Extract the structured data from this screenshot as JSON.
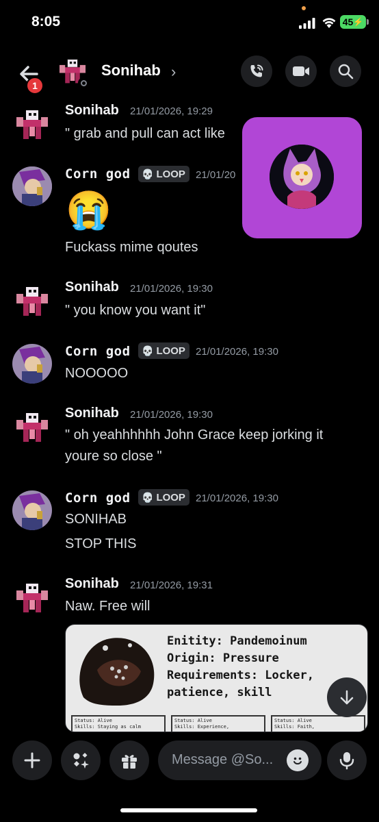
{
  "status_bar": {
    "time": "8:05",
    "battery": "45"
  },
  "header": {
    "name": "Sonihab",
    "chevron": "›",
    "unread_badge": "1",
    "buttons": [
      "back-arrow-icon",
      "phone-call-icon",
      "video-camera-icon",
      "search-icon"
    ]
  },
  "messages": [
    {
      "author": "Sonihab",
      "timestamp": "21/01/2026, 19:29",
      "lines": [
        "\" grab and pull can act like"
      ]
    },
    {
      "author": "Corn god",
      "tag": "LOOP",
      "timestamp": "21/01/20",
      "emoji": "😭",
      "lines": [
        "Fuckass mime qoutes"
      ]
    },
    {
      "author": "Sonihab",
      "timestamp": "21/01/2026, 19:30",
      "lines": [
        "\" you know you want it\""
      ]
    },
    {
      "author": "Corn god",
      "tag": "LOOP",
      "timestamp": "21/01/2026, 19:30",
      "lines": [
        "NOOOOO"
      ]
    },
    {
      "author": "Sonihab",
      "timestamp": "21/01/2026, 19:30",
      "lines": [
        "\" oh yeahhhhhh John Grace keep jorking it",
        "youre so close \""
      ]
    },
    {
      "author": "Corn god",
      "tag": "LOOP",
      "timestamp": "21/01/2026, 19:30",
      "lines": [
        "SONIHAB",
        "STOP THIS"
      ]
    },
    {
      "author": "Sonihab",
      "timestamp": "21/01/2026, 19:31",
      "lines": [
        "Naw. Free will"
      ]
    }
  ],
  "attachment": {
    "text_lines": [
      "Enitity: Pandemoinum",
      "Origin: Pressure",
      "Requirements: Locker,",
      "patience, skill"
    ],
    "cards": [
      {
        "status": "Status: Alive",
        "skills": "Skills: Staying as calm"
      },
      {
        "status": "Status: Alive",
        "skills": "Skills: Experience,"
      },
      {
        "status": "Status: Alive",
        "skills": "Skills: Faith,"
      }
    ]
  },
  "composer": {
    "placeholder": "Message @So..."
  },
  "colors": {
    "background": "#000000",
    "pip": "#b146d6",
    "badge": "#e5383b",
    "battery": "#4cd964"
  }
}
